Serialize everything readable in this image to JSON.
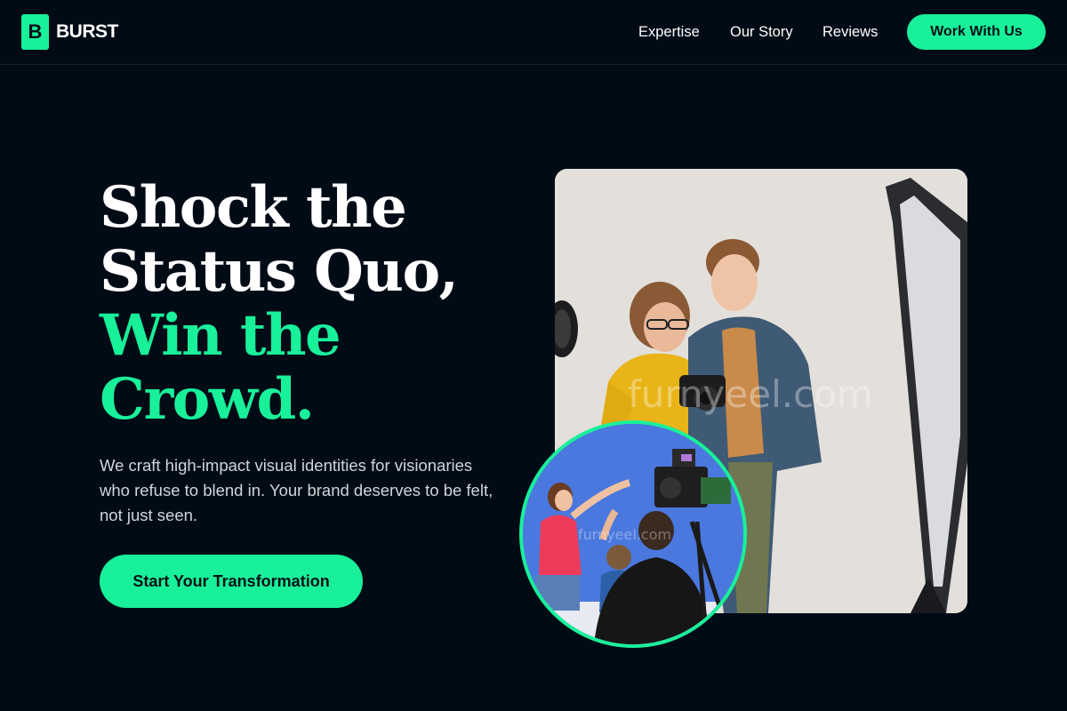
{
  "brand": {
    "mark": "B",
    "name": "BURST",
    "accent": "#19f09a",
    "background": "#010b16"
  },
  "nav": {
    "items": [
      {
        "label": "Expertise"
      },
      {
        "label": "Our Story"
      },
      {
        "label": "Reviews"
      }
    ],
    "cta_label": "Work With Us"
  },
  "hero": {
    "headline_line1": "Shock the",
    "headline_line2": "Status Quo,",
    "headline_line3": "Win the",
    "headline_line4": "Crowd.",
    "subtext": "We craft high-impact visual identities for visionaries who refuse to blend in. Your brand deserves to be felt, not just seen.",
    "cta_label": "Start Your Transformation"
  },
  "images": {
    "main_watermark": "furnyeel.com",
    "circle_watermark": "furnyeel.com"
  }
}
